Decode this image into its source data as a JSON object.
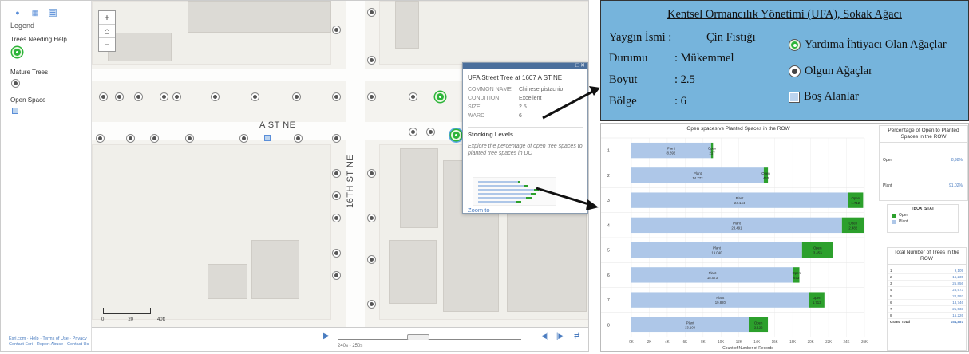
{
  "legend": {
    "tabs": [
      "info-icon",
      "table-icon",
      "list-icon"
    ],
    "heading": "Legend",
    "categories": [
      "Trees Needing Help",
      "Mature Trees",
      "Open Space"
    ],
    "attribution_1": "Esri.com · Help · Terms of Use · Privacy",
    "attribution_2": "Contact Esri · Report Abuse · Contact Us"
  },
  "map": {
    "street_1": "A ST NE",
    "street_2": "16TH ST NE",
    "scale_0": "0",
    "scale_1": "20",
    "scale_2": "40ft",
    "time_label": "240s - 250s"
  },
  "popup": {
    "title": "UFA Street Tree at 1607 A ST NE",
    "rows": [
      {
        "k": "COMMON NAME",
        "v": "Chinese pistachio"
      },
      {
        "k": "CONDITION",
        "v": "Excellent"
      },
      {
        "k": "SIZE",
        "v": "2.5"
      },
      {
        "k": "WARD",
        "v": "6"
      }
    ],
    "section": "Stocking Levels",
    "desc": "Explore the percentage of open tree spaces to planted tree spaces in DC",
    "zoom": "Zoom to",
    "close": "□ ✕"
  },
  "info": {
    "title": "Kentsel Ormancılık Yönetimi (UFA), Sokak Ağacı",
    "rows": [
      {
        "k": "Yaygın İsmi :",
        "v": "Çin Fıstığı"
      },
      {
        "k": "Durumu",
        "v": ": Mükemmel"
      },
      {
        "k": "Boyut",
        "v": ": 2.5"
      },
      {
        "k": "Bölge",
        "v": ": 6"
      }
    ],
    "legend": [
      "Yardıma İhtiyacı Olan Ağaçlar",
      "Olgun Ağaçlar",
      "Boş Alanlar"
    ]
  },
  "dashboard": {
    "pct_title": "Percentage of Open to Planted Spaces in the ROW",
    "pct_rows": [
      {
        "k": "Open",
        "v": "8,98%"
      },
      {
        "k": "Plant",
        "v": "91,02%"
      }
    ],
    "tbox_title": "TBOX_STAT",
    "tbox_items": [
      "Open",
      "Plant"
    ],
    "tot_title": "Total Number of Trees in the ROW",
    "tot_rows": [
      {
        "k": "1",
        "v": "9,109"
      },
      {
        "k": "2",
        "v": "16,235"
      },
      {
        "k": "3",
        "v": "25,856"
      },
      {
        "k": "4",
        "v": "25,973"
      },
      {
        "k": "5",
        "v": "22,593"
      },
      {
        "k": "6",
        "v": "18,746"
      },
      {
        "k": "7",
        "v": "21,533"
      },
      {
        "k": "8",
        "v": "15,226"
      }
    ],
    "tot_grand": {
      "k": "Grand Total",
      "v": "154,887"
    }
  },
  "chart_data": {
    "type": "bar",
    "title": "Open spaces vs Planted Spaces in the ROW",
    "xlabel": "Count of Number of Records",
    "categories": [
      "1",
      "2",
      "3",
      "4",
      "5",
      "6",
      "7",
      "8"
    ],
    "series": [
      {
        "name": "Plant",
        "values": [
          8892,
          14772,
          24144,
          23491,
          19040,
          18073,
          19820,
          13109
        ],
        "labels": [
          "8.892",
          "14.772",
          "24.144",
          "23.491",
          "19.040",
          "18.073",
          "19.820",
          "13.109"
        ]
      },
      {
        "name": "Open",
        "values": [
          217,
          463,
          1712,
          2482,
          3453,
          673,
          1713,
          2122
        ],
        "labels": [
          "217",
          "463",
          "1.712",
          "2.482",
          "3.453",
          "673",
          "1.713",
          "2.122"
        ]
      }
    ],
    "xticks": [
      "0K",
      "2K",
      "4K",
      "6K",
      "8K",
      "10K",
      "12K",
      "14K",
      "16K",
      "18K",
      "20K",
      "22K",
      "24K",
      "26K"
    ],
    "xlim": [
      0,
      26000
    ],
    "colors": {
      "Plant": "#aec7e8",
      "Open": "#2ca02c"
    }
  }
}
